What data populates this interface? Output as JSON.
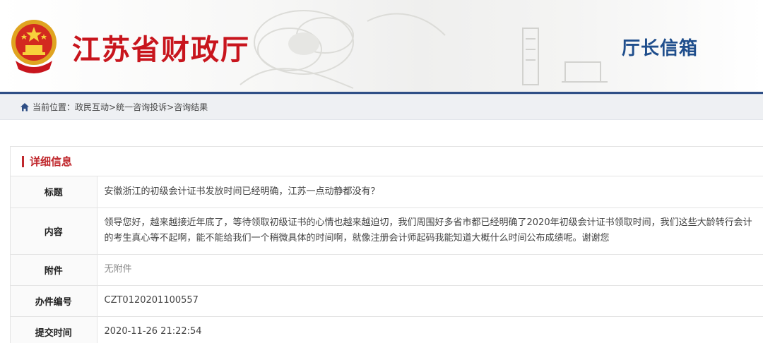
{
  "header": {
    "site_title": "江苏省财政厅",
    "mailbox_title": "厅长信箱"
  },
  "breadcrumb": {
    "prefix": "当前位置：",
    "items": [
      "政民互动",
      "统一咨询投诉",
      "咨询结果"
    ],
    "separator": ">"
  },
  "detail": {
    "heading": "详细信息",
    "rows": [
      {
        "label": "标题",
        "value": "安徽浙江的初级会计证书发放时间已经明确，江苏一点动静都没有？"
      },
      {
        "label": "内容",
        "value": "领导您好，越来越接近年底了，等待领取初级证书的心情也越来越迫切，我们周围好多省市都已经明确了2020年初级会计证书领取时间，我们这些大龄转行会计的考生真心等不起啊，能不能给我们一个稍微具体的时间啊，就像注册会计师起码我能知道大概什么时间公布成绩呢。谢谢您"
      },
      {
        "label": "附件",
        "value": "无附件"
      },
      {
        "label": "办件编号",
        "value": "CZT0120201100557"
      },
      {
        "label": "提交时间",
        "value": "2020-11-26 21:22:54"
      }
    ]
  },
  "colors": {
    "title_red": "#c8151d",
    "mailbox_blue": "#1f4e8c",
    "rule_blue": "#2f4f86",
    "accent_red": "#c0282d"
  },
  "icons": {
    "emblem": "national-emblem-icon",
    "home": "home-icon"
  }
}
